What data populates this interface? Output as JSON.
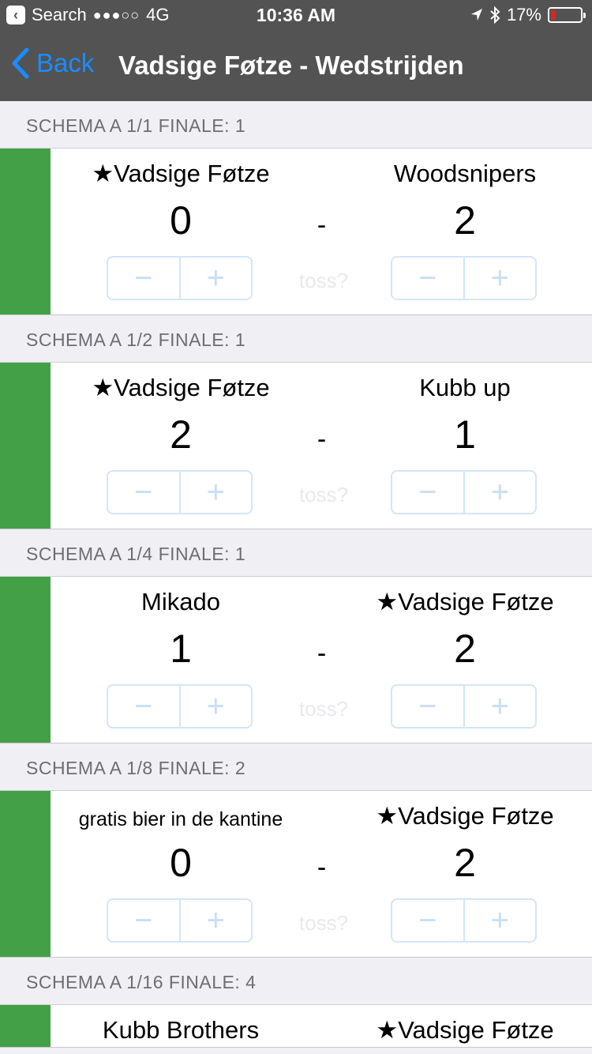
{
  "status_bar": {
    "back_app": "Search",
    "signal": "●●●○○",
    "network": "4G",
    "time": "10:36 AM",
    "battery": "17%",
    "battery_level": 0.17,
    "battery_color": "#e0231e"
  },
  "nav": {
    "back_label": "Back",
    "title": "Vadsige Føtze - Wedstrijden"
  },
  "colors": {
    "accent": "#1a8cff",
    "win": "#43a047"
  },
  "matches": [
    {
      "header": "SCHEMA A 1/1 FINALE: 1",
      "left_team": "★Vadsige Føtze",
      "right_team": "Woodsnipers",
      "left_score": "0",
      "right_score": "2"
    },
    {
      "header": "SCHEMA A 1/2 FINALE: 1",
      "left_team": "★Vadsige Føtze",
      "right_team": "Kubb up",
      "left_score": "2",
      "right_score": "1"
    },
    {
      "header": "SCHEMA A 1/4 FINALE: 1",
      "left_team": "Mikado",
      "right_team": "★Vadsige Føtze",
      "left_score": "1",
      "right_score": "2"
    },
    {
      "header": "SCHEMA A 1/8 FINALE: 2",
      "left_team": "gratis bier in de kantine",
      "right_team": "★Vadsige Føtze",
      "left_score": "0",
      "right_score": "2"
    },
    {
      "header": "SCHEMA A 1/16 FINALE: 4",
      "left_team": "Kubb Brothers",
      "right_team": "★Vadsige Føtze"
    }
  ],
  "labels": {
    "dash": "-",
    "toss": "toss?",
    "minus": "−",
    "plus": "+"
  }
}
